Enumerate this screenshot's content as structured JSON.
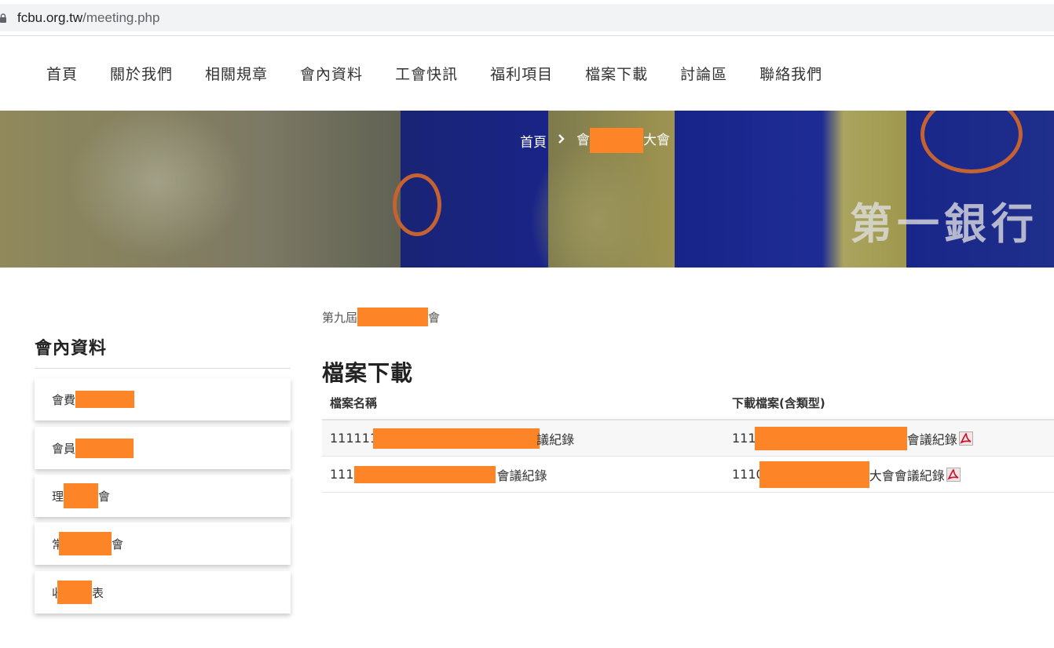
{
  "browser": {
    "url_host": "fcbu.org.tw",
    "url_path": "/meeting.php"
  },
  "nav": {
    "items": [
      "首頁",
      "關於我們",
      "相關規章",
      "會內資料",
      "工會快訊",
      "福利項目",
      "檔案下載",
      "討論區",
      "聯絡我們"
    ]
  },
  "banner": {
    "breadcrumb_home": "首頁",
    "breadcrumb_current_start": "會",
    "breadcrumb_current_end": "大會",
    "banner_text": "第一銀行工"
  },
  "sidebar": {
    "title": "會內資料",
    "items": [
      {
        "prefix": "會費",
        "suffix": ""
      },
      {
        "prefix": "會員",
        "suffix": ""
      },
      {
        "prefix": "理",
        "suffix": "會"
      },
      {
        "prefix": "常",
        "suffix": "會"
      },
      {
        "prefix": "收",
        "suffix": "表"
      }
    ]
  },
  "main": {
    "subtitle_prefix": "第九屆",
    "subtitle_suffix": "會",
    "title": "檔案下載",
    "table": {
      "headers": [
        "檔案名稱",
        "下載檔案(含類型)"
      ],
      "rows": [
        {
          "name_prefix": "111111",
          "name_suffix": "議紀錄",
          "file_prefix": "1111",
          "file_suffix": "會議紀錄"
        },
        {
          "name_prefix": "111",
          "name_suffix": "會議紀錄",
          "file_prefix": "1110",
          "file_suffix": "大會會議紀錄"
        }
      ]
    }
  },
  "colors": {
    "redaction": "#fe8428",
    "pdf": "#c8102e"
  }
}
